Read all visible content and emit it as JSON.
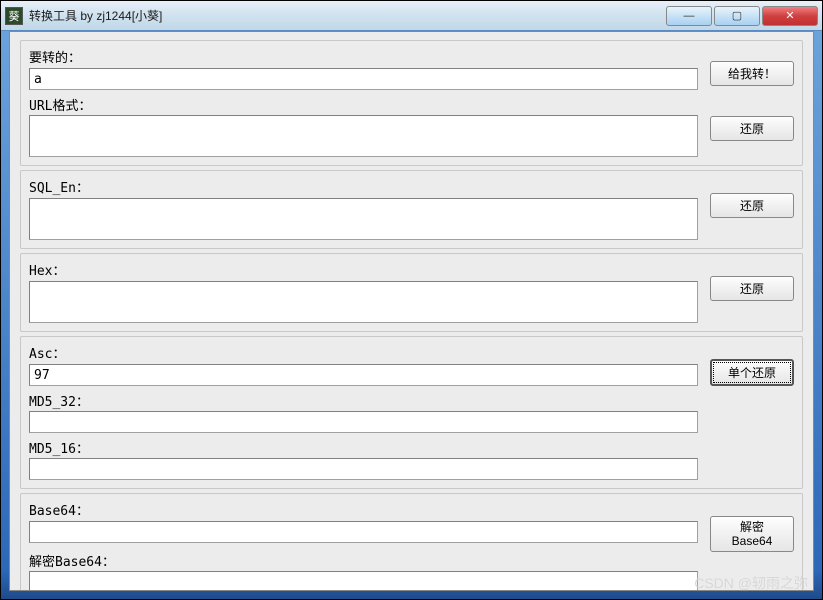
{
  "window": {
    "title": "转换工具 by zj1244[小葵]",
    "icon_char": "葵"
  },
  "buttons": {
    "minimize": "—",
    "maximize": "▢",
    "close": "✕",
    "convert": "给我转！",
    "restore_url": "还原",
    "restore_sql": "还原",
    "restore_hex": "还原",
    "restore_asc": "单个还原",
    "decrypt_base64": "解密\nBase64"
  },
  "fields": {
    "input": {
      "label": "要转的：",
      "value": "a"
    },
    "url": {
      "label": "URL格式：",
      "value": ""
    },
    "sql": {
      "label": "SQL_En：",
      "value": ""
    },
    "hex": {
      "label": "Hex：",
      "value": ""
    },
    "asc": {
      "label": "Asc：",
      "value": "97"
    },
    "md5_32": {
      "label": "MD5_32：",
      "value": ""
    },
    "md5_16": {
      "label": "MD5_16：",
      "value": ""
    },
    "base64": {
      "label": "Base64：",
      "value": ""
    },
    "decrypt_base64": {
      "label": "解密Base64：",
      "value": ""
    }
  },
  "watermark": "CSDN @轫雨之弥"
}
